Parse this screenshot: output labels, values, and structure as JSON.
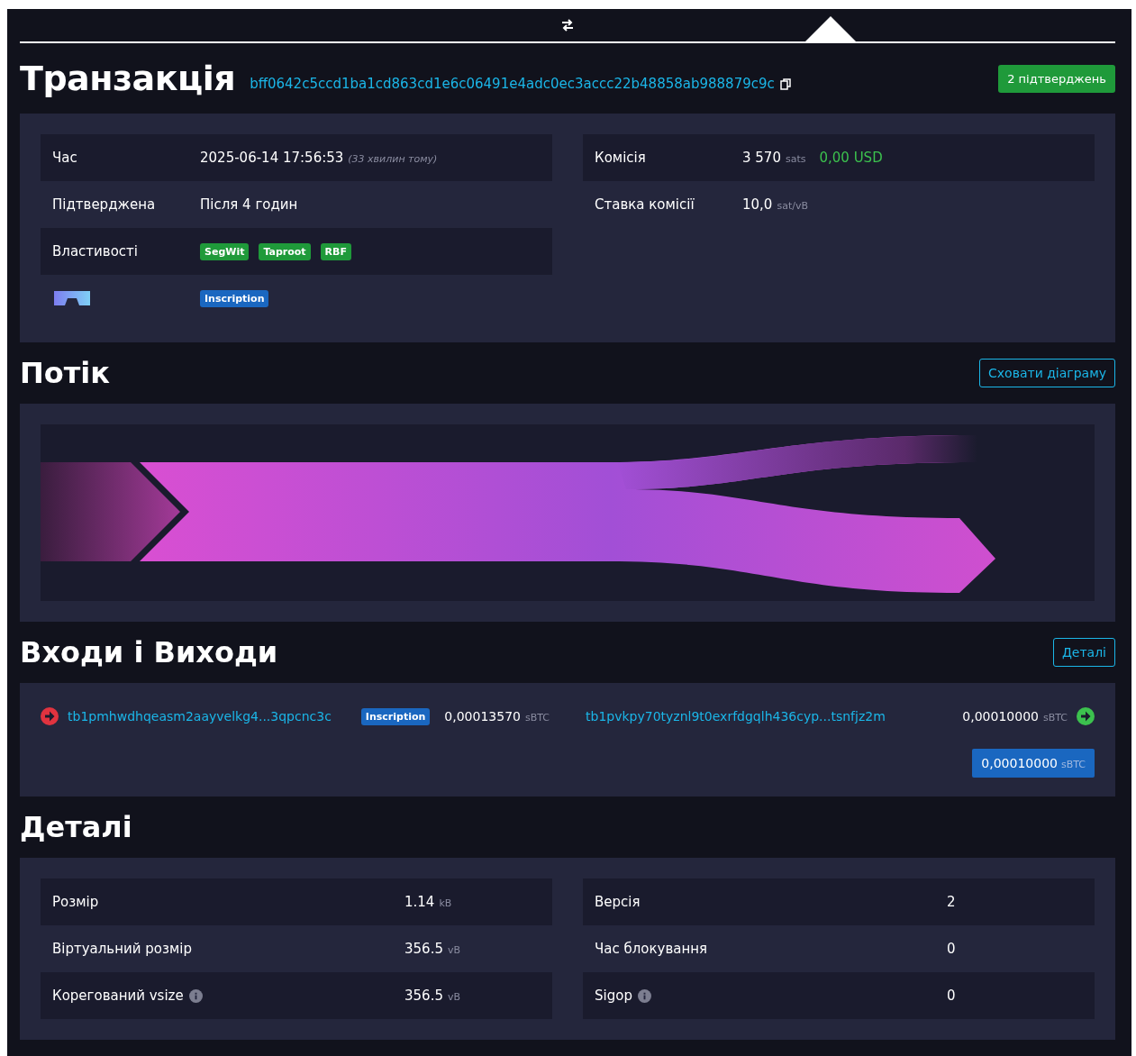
{
  "transaction": {
    "title": "Транзакція",
    "txid": "bff0642c5ccd1ba1cd863cd1e6c06491e4adc0ec3accc22b48858ab988879c9c",
    "confirmations": "2 підтверджень"
  },
  "overview": {
    "left": [
      {
        "kind": "text",
        "label": "Час",
        "value": "2025-06-14 17:56:53",
        "note": "(33 хвилин тому)"
      },
      {
        "kind": "text",
        "label": "Підтверджена",
        "value": "Після 4 годин"
      },
      {
        "kind": "tags",
        "label": "Властивості",
        "tags": [
          {
            "text": "SegWit",
            "color": "#1f9a3a"
          },
          {
            "text": "Taproot",
            "color": "#1f9a3a"
          },
          {
            "text": "RBF",
            "color": "#1f9a3a"
          }
        ]
      },
      {
        "kind": "icon",
        "tags": [
          {
            "text": "Inscription",
            "color": "#1a67c0"
          }
        ]
      }
    ],
    "right": [
      {
        "kind": "text",
        "label": "Комісія",
        "value": "3 570",
        "unit": "sats",
        "fiat": "0,00 USD"
      },
      {
        "kind": "text",
        "label": "Ставка комісії",
        "value": "10,0",
        "unit": "sat/vB"
      }
    ]
  },
  "flow": {
    "title": "Потік",
    "button": "Сховати діаграму"
  },
  "io": {
    "title": "Входи і Виходи",
    "button": "Деталі",
    "inputs": [
      {
        "address": "tb1pmhwdhqeasm2aayvelkg4...3qpcnc3c",
        "tag": "Inscription",
        "amount": "0,00013570",
        "unit": "sBTC"
      }
    ],
    "outputs": [
      {
        "address": "tb1pvkpy70tyznl9t0exrfdgqlh436cyp...tsnfjz2m",
        "amount": "0,00010000",
        "unit": "sBTC"
      }
    ],
    "total": {
      "amount": "0,00010000",
      "unit": "sBTC"
    }
  },
  "details": {
    "title": "Деталі",
    "left": [
      {
        "label": "Розмір",
        "value": "1.14",
        "unit": "kB",
        "info": false
      },
      {
        "label": "Віртуальний розмір",
        "value": "356.5",
        "unit": "vB",
        "info": false
      },
      {
        "label": "Корегований vsize",
        "value": "356.5",
        "unit": "vB",
        "info": true
      }
    ],
    "right": [
      {
        "label": "Версія",
        "value": "2",
        "info": false
      },
      {
        "label": "Час блокування",
        "value": "0",
        "info": false
      },
      {
        "label": "Sigop",
        "value": "0",
        "info": true
      }
    ]
  }
}
